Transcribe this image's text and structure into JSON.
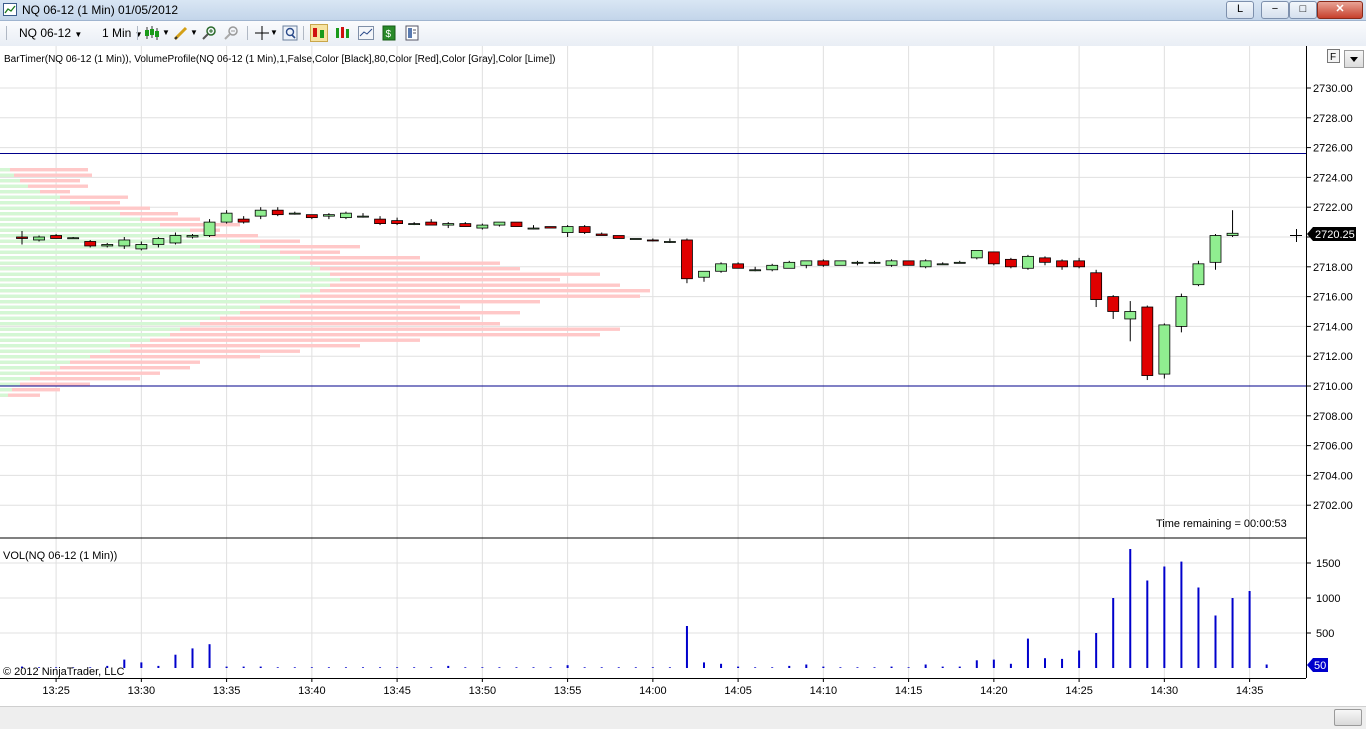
{
  "window": {
    "title": "NQ 06-12 (1 Min)  01/05/2012",
    "link_label": "L",
    "minimize": "−",
    "maximize": "□",
    "close": "✕"
  },
  "toolbar": {
    "instrument": "NQ 06-12",
    "interval": "1 Min",
    "icons": [
      "bar-type-icon",
      "drawing-tool-icon",
      "zoom-in-icon",
      "zoom-out-icon",
      "crosshair-icon",
      "magnify-icon",
      "chart-trader-icon",
      "data-series-icon",
      "indicators-icon",
      "strategies-icon",
      "properties-icon"
    ]
  },
  "price_panel": {
    "indicator_label": "BarTimer(NQ 06-12 (1 Min)), VolumeProfile(NQ 06-12 (1 Min),1,False,Color [Black],80,Color [Red],Color [Gray],Color [Lime])",
    "y_ticks": [
      "2730.00",
      "2728.00",
      "2726.00",
      "2724.00",
      "2722.00",
      "2720.00",
      "2718.00",
      "2716.00",
      "2714.00",
      "2712.00",
      "2710.00",
      "2708.00",
      "2706.00",
      "2704.00",
      "2702.00"
    ],
    "last_price": "2720.25",
    "time_remaining": "Time remaining = 00:00:53",
    "f_button": "F",
    "hlines": [
      2725.6,
      2710.0
    ]
  },
  "volume_panel": {
    "label": "VOL(NQ 06-12 (1 Min))",
    "y_ticks": [
      "1500",
      "1000",
      "500"
    ],
    "last_volume": "50"
  },
  "x_ticks": [
    "13:25",
    "13:30",
    "13:35",
    "13:40",
    "13:45",
    "13:50",
    "13:55",
    "14:00",
    "14:05",
    "14:10",
    "14:15",
    "14:20",
    "14:25",
    "14:30",
    "14:35"
  ],
  "copyright": "© 2012 NinjaTrader, LLC",
  "colors": {
    "up": "#90ee90",
    "down": "#e00000",
    "volume": "#0000cc",
    "line": "#00008b",
    "profile_red": "#ffc8c8",
    "profile_green": "#d4f7d4"
  },
  "chart_data": {
    "type": "candlestick",
    "title": "NQ 06-12 (1 Min)",
    "candles": [
      [
        2720.0,
        2720.4,
        2719.5,
        2719.9
      ],
      [
        2719.8,
        2720.1,
        2719.7,
        2720.0
      ],
      [
        2720.1,
        2720.2,
        2719.9,
        2719.9
      ],
      [
        2719.9,
        2720.0,
        2719.9,
        2719.95
      ],
      [
        2719.7,
        2719.8,
        2719.3,
        2719.4
      ],
      [
        2719.4,
        2719.6,
        2719.3,
        2719.5
      ],
      [
        2719.4,
        2720.0,
        2719.2,
        2719.8
      ],
      [
        2719.2,
        2719.7,
        2719.1,
        2719.5
      ],
      [
        2719.5,
        2720.0,
        2719.3,
        2719.9
      ],
      [
        2719.6,
        2720.3,
        2719.5,
        2720.1
      ],
      [
        2720.0,
        2720.2,
        2719.9,
        2720.1
      ],
      [
        2720.1,
        2721.2,
        2720.0,
        2721.0
      ],
      [
        2721.0,
        2721.8,
        2720.9,
        2721.6
      ],
      [
        2721.2,
        2721.4,
        2720.9,
        2721.0
      ],
      [
        2721.4,
        2722.0,
        2721.2,
        2721.8
      ],
      [
        2721.8,
        2722.0,
        2721.4,
        2721.5
      ],
      [
        2721.6,
        2721.7,
        2721.5,
        2721.6
      ],
      [
        2721.5,
        2721.5,
        2721.2,
        2721.3
      ],
      [
        2721.4,
        2721.6,
        2721.2,
        2721.5
      ],
      [
        2721.3,
        2721.7,
        2721.2,
        2721.6
      ],
      [
        2721.4,
        2721.6,
        2721.3,
        2721.4
      ],
      [
        2721.2,
        2721.4,
        2720.8,
        2720.9
      ],
      [
        2721.1,
        2721.3,
        2720.8,
        2720.9
      ],
      [
        2720.9,
        2721.0,
        2720.8,
        2720.9
      ],
      [
        2721.0,
        2721.2,
        2720.8,
        2720.8
      ],
      [
        2720.8,
        2721.0,
        2720.6,
        2720.9
      ],
      [
        2720.9,
        2721.0,
        2720.7,
        2720.7
      ],
      [
        2720.6,
        2720.9,
        2720.5,
        2720.8
      ],
      [
        2720.8,
        2721.0,
        2720.7,
        2721.0
      ],
      [
        2721.0,
        2721.0,
        2720.7,
        2720.7
      ],
      [
        2720.6,
        2720.8,
        2720.5,
        2720.6
      ],
      [
        2720.7,
        2720.7,
        2720.6,
        2720.6
      ],
      [
        2720.3,
        2720.8,
        2720.0,
        2720.7
      ],
      [
        2720.7,
        2720.8,
        2720.2,
        2720.3
      ],
      [
        2720.2,
        2720.3,
        2720.1,
        2720.1
      ],
      [
        2720.1,
        2720.1,
        2719.9,
        2719.9
      ],
      [
        2719.9,
        2719.9,
        2719.9,
        2719.9
      ],
      [
        2719.8,
        2719.9,
        2719.7,
        2719.75
      ],
      [
        2719.7,
        2719.9,
        2719.6,
        2719.7
      ],
      [
        2719.8,
        2719.9,
        2716.9,
        2717.2
      ],
      [
        2717.3,
        2717.4,
        2717.0,
        2717.7
      ],
      [
        2717.7,
        2718.3,
        2717.6,
        2718.2
      ],
      [
        2718.2,
        2718.3,
        2717.9,
        2717.9
      ],
      [
        2717.8,
        2718.0,
        2717.7,
        2717.8
      ],
      [
        2717.8,
        2718.2,
        2717.7,
        2718.1
      ],
      [
        2717.9,
        2718.4,
        2717.9,
        2718.3
      ],
      [
        2718.1,
        2718.4,
        2717.9,
        2718.4
      ],
      [
        2718.4,
        2718.5,
        2718.0,
        2718.1
      ],
      [
        2718.1,
        2718.4,
        2718.1,
        2718.4
      ],
      [
        2718.3,
        2718.4,
        2718.1,
        2718.3
      ],
      [
        2718.3,
        2718.4,
        2718.2,
        2718.3
      ],
      [
        2718.1,
        2718.5,
        2718.0,
        2718.4
      ],
      [
        2718.4,
        2718.4,
        2718.1,
        2718.1
      ],
      [
        2718.0,
        2718.5,
        2717.9,
        2718.4
      ],
      [
        2718.2,
        2718.3,
        2718.2,
        2718.2
      ],
      [
        2718.3,
        2718.4,
        2718.3,
        2718.3
      ],
      [
        2718.6,
        2719.0,
        2718.5,
        2719.1
      ],
      [
        2719.0,
        2719.0,
        2718.1,
        2718.2
      ],
      [
        2718.5,
        2718.6,
        2717.9,
        2718.0
      ],
      [
        2717.9,
        2718.8,
        2717.8,
        2718.7
      ],
      [
        2718.6,
        2718.7,
        2718.1,
        2718.3
      ],
      [
        2718.4,
        2718.5,
        2717.8,
        2718.0
      ],
      [
        2718.4,
        2718.6,
        2717.9,
        2718.0
      ],
      [
        2717.6,
        2717.8,
        2715.3,
        2715.8
      ],
      [
        2716.0,
        2716.1,
        2714.5,
        2715.0
      ],
      [
        2714.5,
        2715.7,
        2713.0,
        2715.0
      ],
      [
        2715.3,
        2715.4,
        2710.4,
        2710.7
      ],
      [
        2710.8,
        2714.2,
        2710.5,
        2714.1
      ],
      [
        2714.0,
        2716.2,
        2713.6,
        2716.0
      ],
      [
        2716.8,
        2718.4,
        2716.7,
        2718.2
      ],
      [
        2718.3,
        2720.2,
        2717.8,
        2720.1
      ],
      [
        2720.1,
        2721.8,
        2720.0,
        2720.25
      ]
    ],
    "volume": [
      20,
      10,
      10,
      10,
      10,
      30,
      120,
      80,
      30,
      190,
      280,
      340,
      20,
      20,
      20,
      10,
      10,
      10,
      10,
      10,
      10,
      10,
      10,
      10,
      10,
      30,
      10,
      10,
      10,
      10,
      10,
      10,
      40,
      10,
      10,
      10,
      10,
      10,
      10,
      600,
      80,
      60,
      20,
      10,
      10,
      30,
      50,
      20,
      10,
      10,
      10,
      20,
      10,
      50,
      20,
      20,
      110,
      120,
      60,
      420,
      140,
      130,
      250,
      500,
      1000,
      1700,
      1250,
      1450,
      1520,
      1150,
      750,
      1000,
      1100,
      50
    ],
    "x_start": "13:23",
    "interval_minutes": 1
  }
}
